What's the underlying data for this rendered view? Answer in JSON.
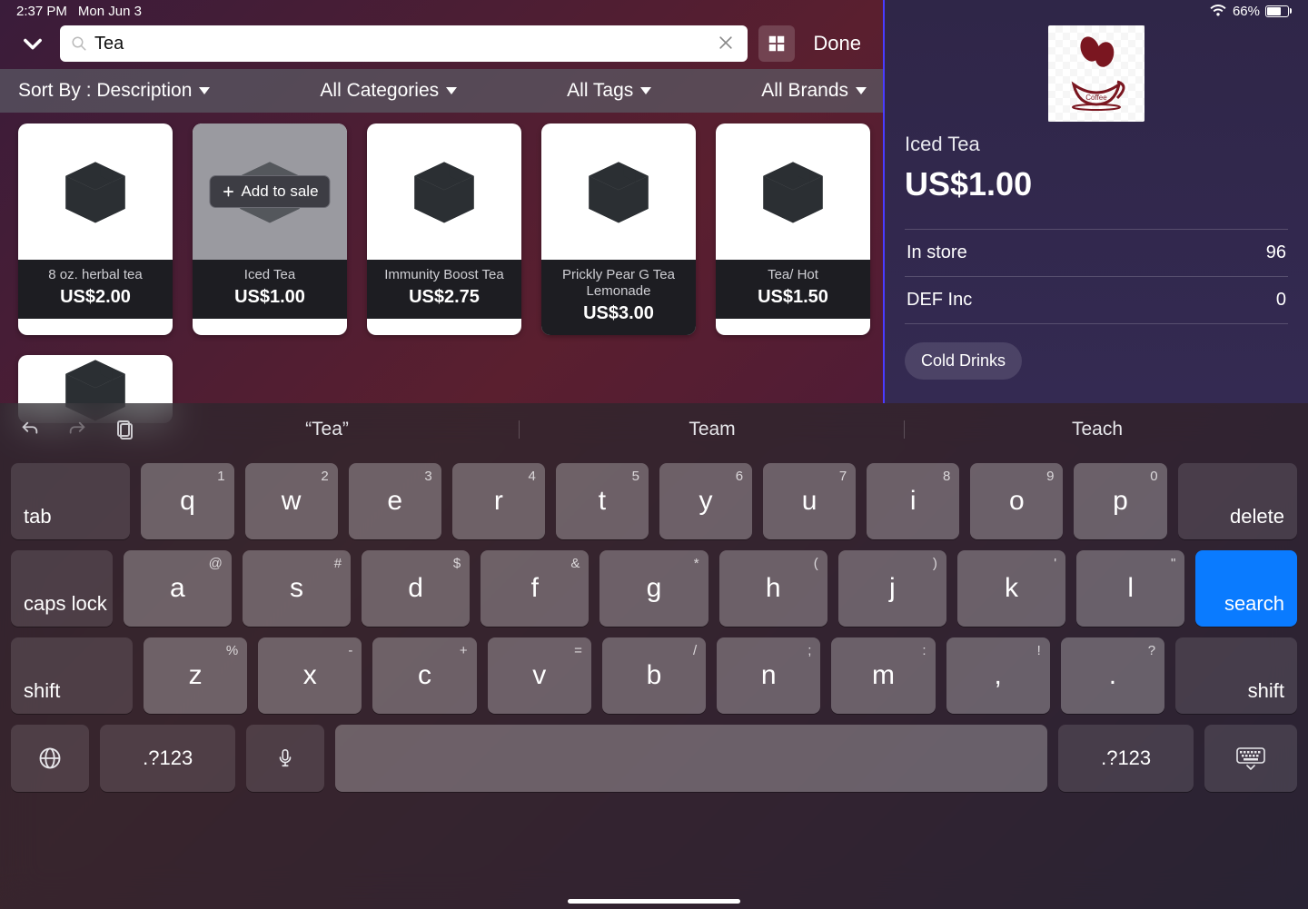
{
  "status": {
    "time": "2:37 PM",
    "date": "Mon Jun 3",
    "battery_pct": "66%"
  },
  "header": {
    "search_value": "Tea",
    "search_placeholder": "",
    "done": "Done"
  },
  "filters": {
    "sort_label": "Sort By : Description",
    "categories": "All Categories",
    "tags": "All Tags",
    "brands": "All Brands"
  },
  "add_to_sale": "Add to sale",
  "products": [
    {
      "name": "8 oz. herbal tea",
      "price": "US$2.00"
    },
    {
      "name": "Iced Tea",
      "price": "US$1.00",
      "selected": true
    },
    {
      "name": "Immunity Boost Tea",
      "price": "US$2.75"
    },
    {
      "name": "Prickly Pear G Tea Lemonade",
      "price": "US$3.00",
      "two": true
    },
    {
      "name": "Tea/ Hot",
      "price": "US$1.50"
    }
  ],
  "detail": {
    "title": "Iced Tea",
    "price": "US$1.00",
    "rows": [
      {
        "label": "In store",
        "value": "96"
      },
      {
        "label": "DEF Inc",
        "value": "0"
      }
    ],
    "tag": "Cold Drinks",
    "logo_caption": "Coffee"
  },
  "keyboard": {
    "suggestions": [
      "“Tea”",
      "Team",
      "Teach"
    ],
    "row1": [
      {
        "k": "q",
        "s": "1"
      },
      {
        "k": "w",
        "s": "2"
      },
      {
        "k": "e",
        "s": "3"
      },
      {
        "k": "r",
        "s": "4"
      },
      {
        "k": "t",
        "s": "5"
      },
      {
        "k": "y",
        "s": "6"
      },
      {
        "k": "u",
        "s": "7"
      },
      {
        "k": "i",
        "s": "8"
      },
      {
        "k": "o",
        "s": "9"
      },
      {
        "k": "p",
        "s": "0"
      }
    ],
    "row2": [
      {
        "k": "a",
        "s": "@"
      },
      {
        "k": "s",
        "s": "#"
      },
      {
        "k": "d",
        "s": "$"
      },
      {
        "k": "f",
        "s": "&"
      },
      {
        "k": "g",
        "s": "*"
      },
      {
        "k": "h",
        "s": "("
      },
      {
        "k": "j",
        "s": ")"
      },
      {
        "k": "k",
        "s": "'"
      },
      {
        "k": "l",
        "s": "\""
      }
    ],
    "row3": [
      {
        "k": "z",
        "s": "%"
      },
      {
        "k": "x",
        "s": "-"
      },
      {
        "k": "c",
        "s": "+"
      },
      {
        "k": "v",
        "s": "="
      },
      {
        "k": "b",
        "s": "/"
      },
      {
        "k": "n",
        "s": ";"
      },
      {
        "k": "m",
        "s": ":"
      },
      {
        "k": ",",
        "s": "!"
      },
      {
        "k": ".",
        "s": "?"
      }
    ],
    "mods": {
      "tab": "tab",
      "delete": "delete",
      "caps": "caps lock",
      "search": "search",
      "shift": "shift",
      "num": ".?123"
    }
  }
}
